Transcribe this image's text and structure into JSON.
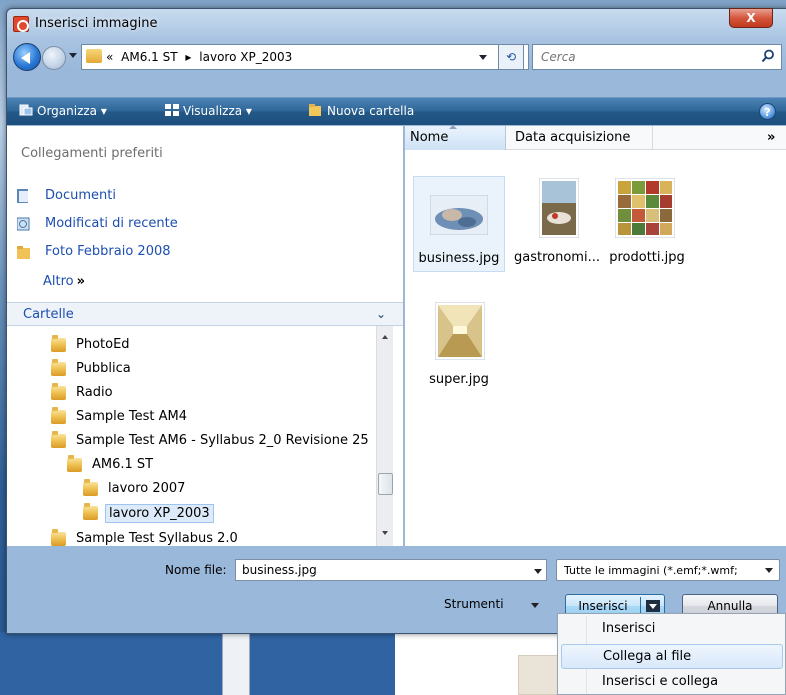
{
  "window": {
    "title": "Inserisci immagine",
    "close_label": "X"
  },
  "address": {
    "crumbs": [
      "«",
      "AM6.1 ST",
      "▸",
      "lavoro XP_2003"
    ],
    "refresh_label": "⟲",
    "search_placeholder": "Cerca"
  },
  "toolbar": {
    "organize": "Organizza",
    "view": "Visualizza",
    "new_folder": "Nuova cartella",
    "help": "?"
  },
  "favorites": {
    "header": "Collegamenti preferiti",
    "items": [
      {
        "label": "Documenti",
        "icon": "documents-icon"
      },
      {
        "label": "Modificati di recente",
        "icon": "recent-icon"
      },
      {
        "label": "Foto Febbraio 2008",
        "icon": "folder-icon"
      }
    ],
    "more": "Altro",
    "more_chevron": "»"
  },
  "folders": {
    "header": "Cartelle",
    "items": [
      {
        "label": "PhotoEd"
      },
      {
        "label": "Pubblica"
      },
      {
        "label": "Radio"
      },
      {
        "label": "Sample Test AM4"
      },
      {
        "label": "Sample Test AM6 - Syllabus 2_0 Revisione 25"
      },
      {
        "label": "AM6.1 ST"
      },
      {
        "label": "lavoro 2007"
      },
      {
        "label": "lavoro XP_2003"
      },
      {
        "label": "Sample Test Syllabus 2.0"
      }
    ]
  },
  "file_list": {
    "columns": [
      "Nome",
      "Data acquisizione",
      "»"
    ],
    "files": [
      {
        "name": "business.jpg",
        "selected": true
      },
      {
        "name": "gastronomi...",
        "selected": false
      },
      {
        "name": "prodotti.jpg",
        "selected": false
      },
      {
        "name": "super.jpg",
        "selected": false
      }
    ]
  },
  "bottom": {
    "filename_label": "Nome file:",
    "filename_value": "business.jpg",
    "filetype_value": "Tutte le immagini (*.emf;*.wmf;",
    "tools_label": "Strumenti",
    "insert_button": "Inserisci",
    "cancel_button": "Annulla"
  },
  "insert_menu": {
    "items": [
      "Inserisci",
      "Collega al file",
      "Inserisci e collega"
    ],
    "hovered": "Collega al file"
  },
  "colors": {
    "link_blue": "#1d4eb1",
    "toolbar_bg": "#2e6598",
    "frame": "#9ab8da"
  }
}
